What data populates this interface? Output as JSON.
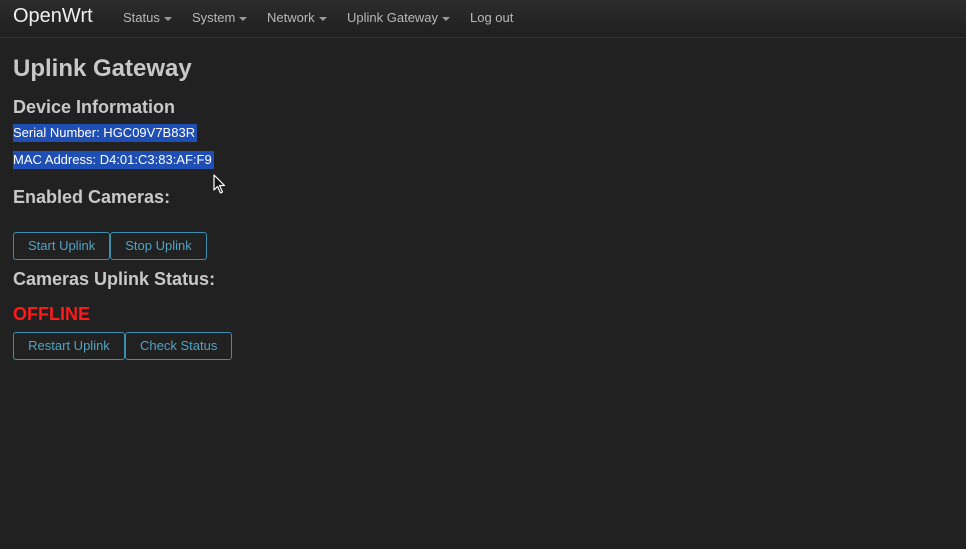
{
  "navbar": {
    "brand": "OpenWrt",
    "items": [
      {
        "label": "Status",
        "dropdown": true
      },
      {
        "label": "System",
        "dropdown": true
      },
      {
        "label": "Network",
        "dropdown": true
      },
      {
        "label": "Uplink Gateway",
        "dropdown": true
      },
      {
        "label": "Log out",
        "dropdown": false
      }
    ]
  },
  "page": {
    "title": "Uplink Gateway",
    "device_info": {
      "heading": "Device Information",
      "serial": "Serial Number: HGC09V7B83R",
      "mac": "MAC Address: D4:01:C3:83:AF:F9"
    },
    "cameras": {
      "heading": "Enabled Cameras:",
      "start_label": "Start Uplink",
      "stop_label": "Stop Uplink"
    },
    "status": {
      "heading": "Cameras Uplink Status:",
      "value": "OFFLINE",
      "restart_label": "Restart Uplink",
      "check_label": "Check Status"
    }
  },
  "colors": {
    "background": "#212121",
    "offline": "#ff1a1a",
    "button_accent": "#4fa3c4",
    "selection": "#1f4fb4"
  }
}
